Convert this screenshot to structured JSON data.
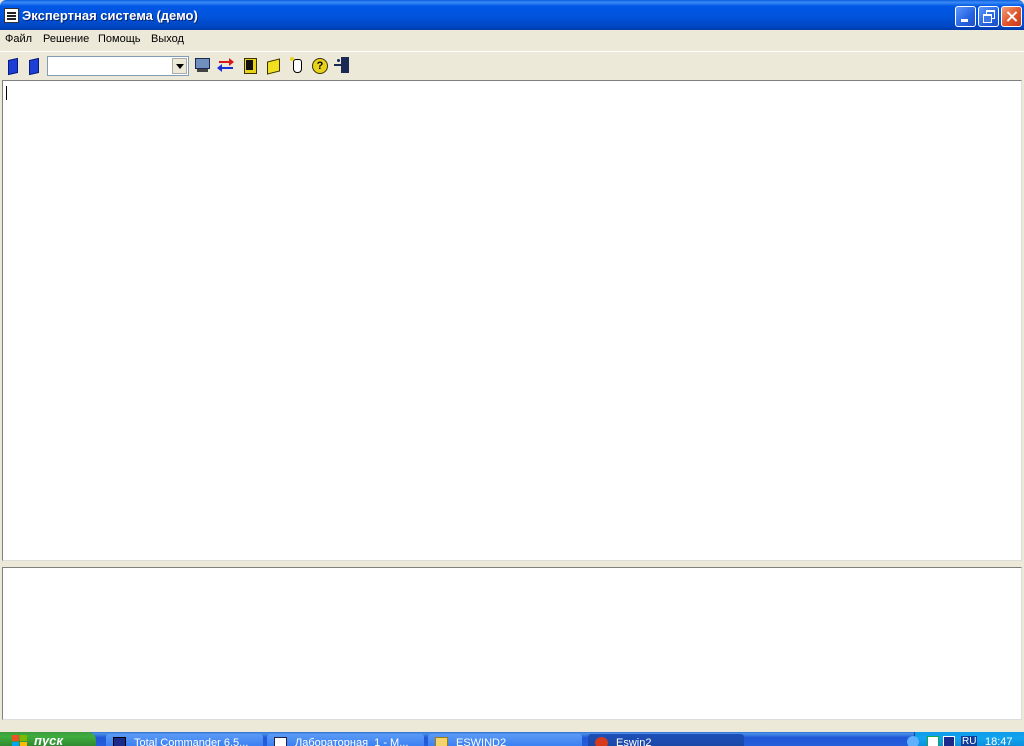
{
  "window": {
    "title": "Экспертная система (демо)",
    "controls": [
      "minimize",
      "restore",
      "close"
    ]
  },
  "menu": {
    "items": [
      "Файл",
      "Решение",
      "Помощь",
      "Выход"
    ]
  },
  "toolbar": {
    "combo_value": "",
    "buttons": [
      {
        "icon": "blue-book-icon"
      },
      {
        "icon": "blue-book-icon"
      },
      {
        "icon": "computer-icon"
      },
      {
        "icon": "swap-arrows-icon"
      },
      {
        "icon": "yellow-book-icon"
      },
      {
        "icon": "yellow-box-icon"
      },
      {
        "icon": "pointer-icon"
      },
      {
        "icon": "help-icon"
      },
      {
        "icon": "exit-icon"
      }
    ]
  },
  "editor": {
    "content": ""
  },
  "output": {
    "content": ""
  },
  "taskbar": {
    "start_label": "пуск",
    "tasks": [
      {
        "label": "Total Commander 6.5...",
        "icon": "floppy-icon",
        "active": false
      },
      {
        "label": "Лабораторная_1 - M...",
        "icon": "document-icon",
        "active": false
      },
      {
        "label": "ESWIND2",
        "icon": "folder-icon",
        "active": false
      },
      {
        "label": "Eswin2",
        "icon": "app-icon",
        "active": true
      }
    ],
    "tray": {
      "language": "RU",
      "time": "18:47"
    }
  },
  "colors": {
    "titlebar": "#0054e3",
    "face": "#ece9d8",
    "taskbar": "#245edb",
    "start": "#3c9a3c"
  }
}
